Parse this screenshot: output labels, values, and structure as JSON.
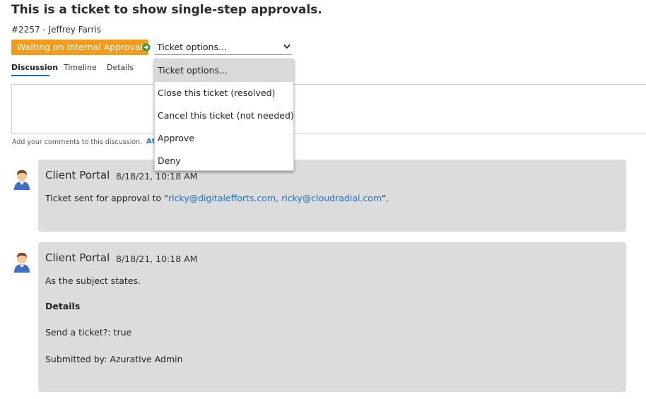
{
  "ticket": {
    "title": "This is a ticket to show single-step approvals.",
    "meta": "#2257 - Jeffrey Farris",
    "status": "Waiting on Internal Approval",
    "status_color": "#f29b1d"
  },
  "options_select": {
    "value": "Ticket options...",
    "items": [
      "Ticket options...",
      "Close this ticket (resolved)",
      "Cancel this ticket (not needed)",
      "Approve",
      "Deny"
    ]
  },
  "tabs": [
    {
      "label": "Discussion",
      "active": true
    },
    {
      "label": "Timeline",
      "active": false
    },
    {
      "label": "Details",
      "active": false
    }
  ],
  "comment": {
    "placeholder": "",
    "hint": "Add your comments to this discussion.",
    "attach_label": "At"
  },
  "posts": [
    {
      "author": "Client Portal",
      "time": "8/18/21, 10:18 AM",
      "text_prefix": "Ticket sent for approval to \"",
      "link_text": "ricky@digitalefforts.com, ricky@cloudradial.com",
      "text_suffix": "\"."
    },
    {
      "author": "Client Portal",
      "time": "8/18/21, 10:18 AM",
      "lines": [
        "As the subject states.",
        "Details",
        "Send a ticket?: true",
        "Submitted by: Azurative Admin"
      ]
    }
  ],
  "colors": {
    "accent": "#1f6fbf",
    "card_bg": "#dcdcdc",
    "go_icon": "#2e9a3a"
  },
  "icons": {
    "status_action": "arrow-right-circle-icon",
    "select_chevron": "chevron-down-icon",
    "avatar": "user-avatar-icon"
  }
}
